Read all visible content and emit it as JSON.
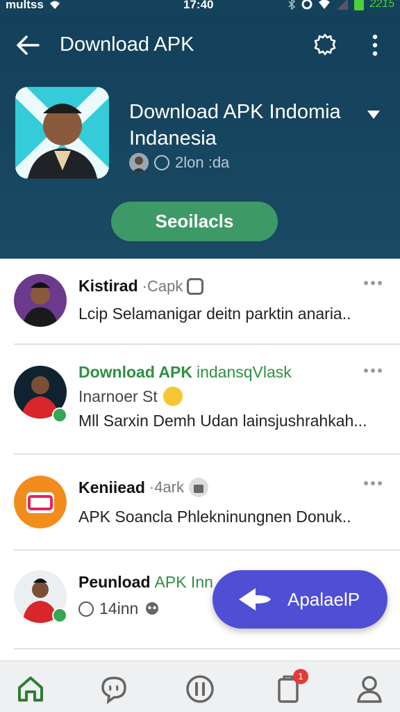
{
  "status_bar": {
    "carrier": "multss",
    "time": "17:40",
    "battery_text": "2215"
  },
  "toolbar": {
    "title": "Download APK",
    "back_icon": "arrow-left-icon",
    "settings_icon": "gear-icon",
    "more_icon": "more-vertical-icon"
  },
  "app": {
    "title": "Download APK Indomia Indanesia",
    "meta": "2lon :da",
    "primary_button_label": "Seoilacls"
  },
  "feed": [
    {
      "name": "Kistirad",
      "time": "·Capk",
      "body": "Lcip Selamanigar deitn parktin anaria.."
    },
    {
      "name": "Download APK",
      "subtitle": "indansqVlask",
      "secondary": "Inarnoer St",
      "body": "Mll Sarxin Demh Udan lainsjushrahkah..."
    },
    {
      "name": "Keniiead",
      "time": "·4ark",
      "body": "APK Soancla Phlekninungnen Donuk.."
    },
    {
      "name": "Peunload",
      "name_highlight": "APK Inn",
      "secondary": "14inn"
    }
  ],
  "fab": {
    "label": "ApalaelP"
  },
  "bottom_nav": {
    "items": [
      "home-icon",
      "chat-icon",
      "pause-icon",
      "clipboard-icon",
      "profile-icon"
    ],
    "badge": "1"
  },
  "colors": {
    "header_bg": "#14425a",
    "accent_green": "#3d9a66",
    "fab_purple": "#4f4fd6",
    "link_green": "#2e9043"
  }
}
